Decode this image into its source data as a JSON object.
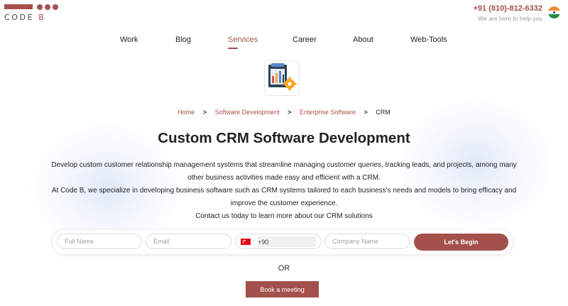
{
  "brand": {
    "logo_text_main": "CODE",
    "logo_text_accent": "B",
    "accent": "#a4504c"
  },
  "contact": {
    "phone": "+91 (810)-812-6332",
    "tagline": "We are here to help you",
    "country_flag": "india-flag-icon"
  },
  "nav": {
    "items": [
      {
        "label": "Work"
      },
      {
        "label": "Blog"
      },
      {
        "label": "Services",
        "active": true
      },
      {
        "label": "Career"
      },
      {
        "label": "About"
      },
      {
        "label": "Web-Tools"
      }
    ]
  },
  "hero_icon": "crm-software-gear-icon",
  "breadcrumb": {
    "items": [
      "Home",
      "Software Development",
      "Enterprise Software"
    ],
    "current": "CRM",
    "separator": ">"
  },
  "main": {
    "title": "Custom CRM Software Development",
    "paragraphs": [
      "Develop custom customer relationship management systems that streamline managing customer queries, tracking leads, and projects, among many other business activities made easy and efficient with a CRM.",
      "At Code B, we specialize in developing business software such as CRM systems tailored to each business's needs and models to bring efficacy and improve the customer experience.",
      "Contact us today to learn more about our CRM solutions"
    ]
  },
  "form": {
    "full_name_placeholder": "Full Name",
    "email_placeholder": "Email",
    "phone_code": "+90",
    "phone_country_flag": "turkey-flag-icon",
    "company_placeholder": "Company Name",
    "submit_label": "Let's Begin"
  },
  "or_label": "OR",
  "meeting_label": "Book a meeting"
}
